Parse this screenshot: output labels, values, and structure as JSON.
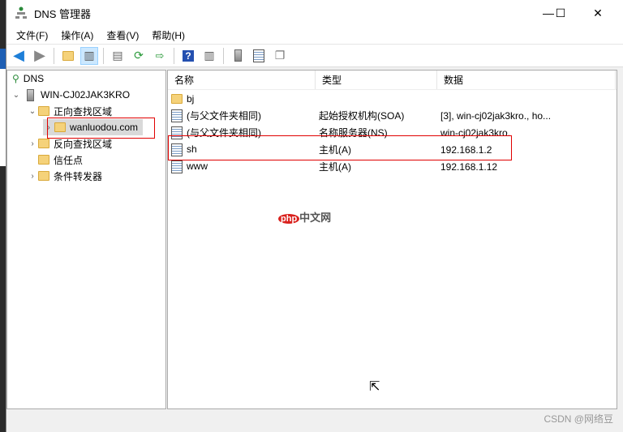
{
  "window": {
    "title": "DNS 管理器",
    "minimize": "—",
    "maximize": "☐",
    "close": "✕"
  },
  "menu": [
    "文件(F)",
    "操作(A)",
    "查看(V)",
    "帮助(H)"
  ],
  "tree": {
    "root": "DNS",
    "server": "WIN-CJ02JAK3KRO",
    "forward": "正向查找区域",
    "zone": "wanluodou.com",
    "reverse": "反向查找区域",
    "trust": "信任点",
    "cond": "条件转发器"
  },
  "list": {
    "headers": [
      "名称",
      "类型",
      "数据"
    ],
    "rows": [
      {
        "name": "bj",
        "type": "",
        "data": "",
        "icon": "folder"
      },
      {
        "name": "(与父文件夹相同)",
        "type": "起始授权机构(SOA)",
        "data": "[3], win-cj02jak3kro., ho...",
        "icon": "record"
      },
      {
        "name": "(与父文件夹相同)",
        "type": "名称服务器(NS)",
        "data": "win-cj02jak3kro.",
        "icon": "record"
      },
      {
        "name": "sh",
        "type": "主机(A)",
        "data": "192.168.1.2",
        "icon": "record"
      },
      {
        "name": "www",
        "type": "主机(A)",
        "data": "192.168.1.12",
        "icon": "record"
      }
    ]
  },
  "watermark": "CSDN @网络豆",
  "logo": {
    "php": "php",
    "text": "中文网"
  }
}
